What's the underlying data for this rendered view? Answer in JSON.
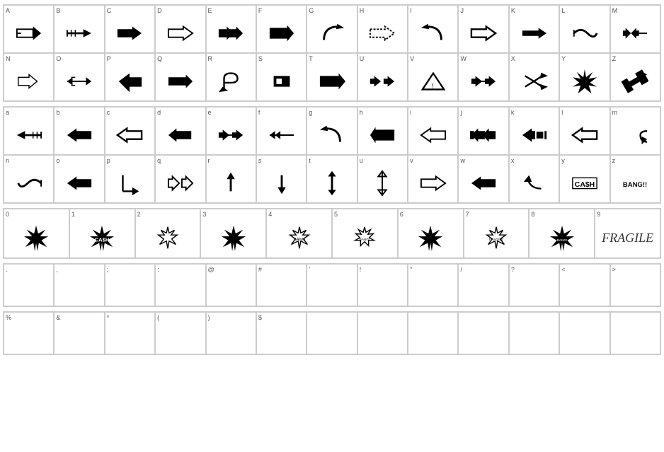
{
  "uppercase": {
    "rows": [
      {
        "cells": [
          {
            "label": "A",
            "symbol": "arrow_right_box"
          },
          {
            "label": "B",
            "symbol": "arrow_right_striped"
          },
          {
            "label": "C",
            "symbol": "arrow_right_bold"
          },
          {
            "label": "D",
            "symbol": "arrow_right_outline"
          },
          {
            "label": "E",
            "symbol": "arrows_right_triple"
          },
          {
            "label": "F",
            "symbol": "arrow_right_wide"
          },
          {
            "label": "G",
            "symbol": "arrow_curved_right"
          },
          {
            "label": "H",
            "symbol": "arrow_right_dotted"
          },
          {
            "label": "I",
            "symbol": "arrow_curved_left"
          },
          {
            "label": "J",
            "symbol": "arrow_right_outline2"
          },
          {
            "label": "K",
            "symbol": "arrow_right_solid"
          },
          {
            "label": "L",
            "symbol": "arrow_wavy"
          },
          {
            "label": "M",
            "symbol": "arrows_lr"
          }
        ]
      },
      {
        "cells": [
          {
            "label": "N",
            "symbol": "arrow_right_thin"
          },
          {
            "label": "O",
            "symbol": "arrows_right_double_thin"
          },
          {
            "label": "P",
            "symbol": "arrow_down_left"
          },
          {
            "label": "Q",
            "symbol": "arrow_right_chunky"
          },
          {
            "label": "R",
            "symbol": "arrow_return"
          },
          {
            "label": "S",
            "symbol": "arrow_right_square"
          },
          {
            "label": "T",
            "symbol": "arrow_right_big"
          },
          {
            "label": "U",
            "symbol": "arrows_lr_bold"
          },
          {
            "label": "V",
            "symbol": "triangle_warning"
          },
          {
            "label": "W",
            "symbol": "arrows_lr2"
          },
          {
            "label": "X",
            "symbol": "arrow_curved_lr"
          },
          {
            "label": "Y",
            "symbol": "starburst_spiky"
          },
          {
            "label": "Z",
            "symbol": "arrow_up_right"
          }
        ]
      }
    ]
  },
  "lowercase": {
    "rows": [
      {
        "cells": [
          {
            "label": "a",
            "symbol": "arrow_left_striped"
          },
          {
            "label": "b",
            "symbol": "arrow_left_bold"
          },
          {
            "label": "c",
            "symbol": "arrow_left_outline"
          },
          {
            "label": "d",
            "symbol": "arrow_left_chunky"
          },
          {
            "label": "e",
            "symbol": "arrows_lr_bold2"
          },
          {
            "label": "f",
            "symbol": "arrows_left_double"
          },
          {
            "label": "g",
            "symbol": "arrow_curved_left2"
          },
          {
            "label": "h",
            "symbol": "arrow_left_big"
          },
          {
            "label": "i",
            "symbol": "arrow_left_outline2"
          },
          {
            "label": "j",
            "symbol": "arrows_left_triple"
          },
          {
            "label": "k",
            "symbol": "arrow_left_square"
          },
          {
            "label": "l",
            "symbol": "arrow_left_outline3"
          },
          {
            "label": "m",
            "symbol": "arrow_curved_left3"
          }
        ]
      },
      {
        "cells": [
          {
            "label": "n",
            "symbol": "arrow_wavy_left"
          },
          {
            "label": "o",
            "symbol": "arrow_left_solid"
          },
          {
            "label": "p",
            "symbol": "arrow_down_return"
          },
          {
            "label": "q",
            "symbol": "arrows_lr_outline"
          },
          {
            "label": "r",
            "symbol": "arrow_up"
          },
          {
            "label": "s",
            "symbol": "arrow_down"
          },
          {
            "label": "t",
            "symbol": "arrows_ud"
          },
          {
            "label": "u",
            "symbol": "arrows_ud_outline"
          },
          {
            "label": "v",
            "symbol": "arrow_right_outline3"
          },
          {
            "label": "w",
            "symbol": "arrow_left_filled"
          },
          {
            "label": "x",
            "symbol": "arrow_curved_right2"
          },
          {
            "label": "y",
            "symbol": "text_cash"
          },
          {
            "label": "z",
            "symbol": "text_bang"
          }
        ]
      }
    ]
  },
  "numbers": {
    "cells": [
      {
        "label": "0",
        "symbol": "burst_0"
      },
      {
        "label": "1",
        "symbol": "burst_1"
      },
      {
        "label": "2",
        "symbol": "burst_2"
      },
      {
        "label": "3",
        "symbol": "burst_3"
      },
      {
        "label": "4",
        "symbol": "burst_4"
      },
      {
        "label": "5",
        "symbol": "burst_5"
      },
      {
        "label": "6",
        "symbol": "burst_6"
      },
      {
        "label": "7",
        "symbol": "burst_7"
      },
      {
        "label": "8",
        "symbol": "burst_8"
      },
      {
        "label": "9",
        "symbol": "text_fragile"
      }
    ]
  },
  "punctuation": {
    "cells": [
      {
        "label": ".",
        "symbol": ""
      },
      {
        "label": ",",
        "symbol": ""
      },
      {
        "label": ";",
        "symbol": ""
      },
      {
        "label": ":",
        "symbol": ""
      },
      {
        "label": "@",
        "symbol": ""
      },
      {
        "label": "#",
        "symbol": ""
      },
      {
        "label": "'",
        "symbol": ""
      },
      {
        "label": "!",
        "symbol": ""
      },
      {
        "label": "\"",
        "symbol": ""
      },
      {
        "label": "/",
        "symbol": ""
      },
      {
        "label": "?",
        "symbol": ""
      },
      {
        "label": "<",
        "symbol": ""
      },
      {
        "label": ">",
        "symbol": ""
      }
    ]
  },
  "symbols": {
    "cells": [
      {
        "label": "%",
        "symbol": ""
      },
      {
        "label": "&",
        "symbol": ""
      },
      {
        "label": "*",
        "symbol": ""
      },
      {
        "label": "(",
        "symbol": ""
      },
      {
        "label": ")",
        "symbol": ""
      },
      {
        "label": "$",
        "symbol": ""
      }
    ]
  }
}
